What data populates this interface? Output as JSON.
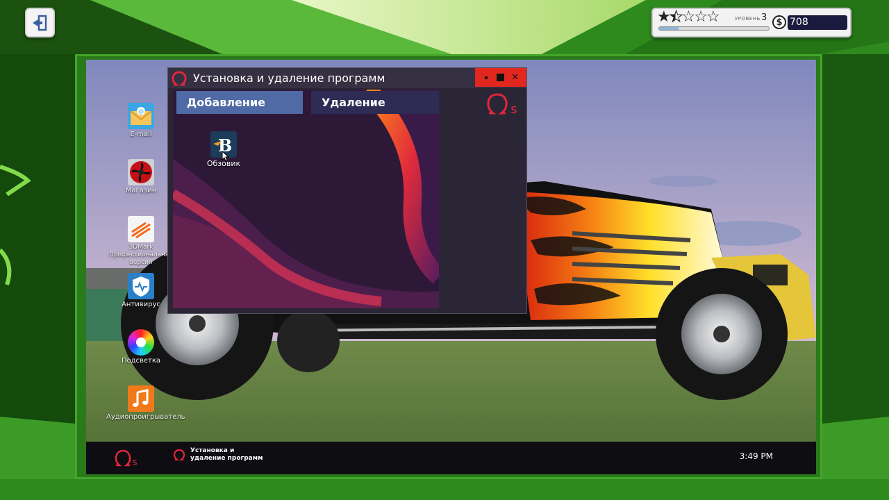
{
  "hud": {
    "stars_total": 5,
    "stars_filled": 1.5,
    "level_label": "УРОВЕНЬ",
    "level": "3",
    "xp_progress": 0.18,
    "currency_symbol": "$",
    "money": "708"
  },
  "desktop": {
    "icons": [
      {
        "name": "email",
        "label": "E-mail",
        "icon": "mail-icon"
      },
      {
        "name": "shop",
        "label": "Магазин",
        "icon": "fan-icon"
      },
      {
        "name": "3dmark",
        "label": "3DMark Профессиональная версия",
        "icon": "3dmark-icon"
      },
      {
        "name": "antivirus",
        "label": "Антивирус",
        "icon": "shield-pulse-icon"
      },
      {
        "name": "rgb",
        "label": "Подсветка",
        "icon": "color-wheel-icon"
      },
      {
        "name": "audio",
        "label": "Аудиопроигрыватель",
        "icon": "music-note-icon"
      }
    ]
  },
  "window": {
    "title": "Установка и удаление программ",
    "tabs": [
      {
        "label": "Добавление",
        "active": true
      },
      {
        "label": "Удаление",
        "active": false
      }
    ],
    "apps": [
      {
        "label": "Обзовик",
        "icon": "letter-b-icon"
      }
    ]
  },
  "taskbar": {
    "app_label": "Установка и удаление программ",
    "clock": "3:49 PM"
  },
  "colors": {
    "accent_red": "#e2271f",
    "os_logo": "#e0263c",
    "tab_active": "#4f6aa4",
    "tab_inactive": "#2e2b55"
  }
}
